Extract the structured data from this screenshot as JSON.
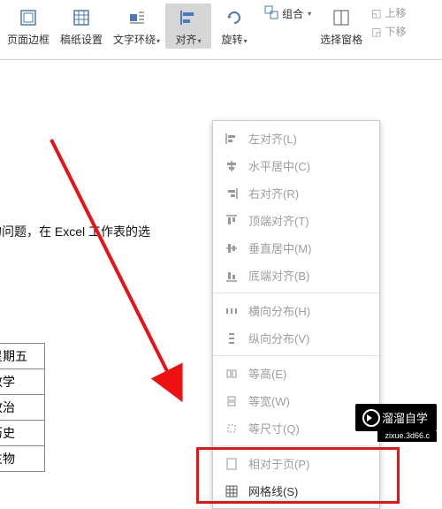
{
  "toolbar": {
    "page_border": "页面边框",
    "paper_setup": "稿纸设置",
    "text_wrap": "文字环绕",
    "align": "对齐",
    "rotate": "旋转",
    "group": "组合",
    "select_pane": "选择窗格",
    "move_up": "上移",
    "move_down": "下移"
  },
  "dropdown": {
    "items": [
      {
        "label": "左对齐(L)"
      },
      {
        "label": "水平居中(C)"
      },
      {
        "label": "右对齐(R)"
      },
      {
        "label": "顶端对齐(T)"
      },
      {
        "label": "垂直居中(M)"
      },
      {
        "label": "底端对齐(B)"
      },
      {
        "label": "横向分布(H)"
      },
      {
        "label": "纵向分布(V)"
      },
      {
        "label": "等高(E)"
      },
      {
        "label": "等宽(W)"
      },
      {
        "label": "等尺寸(Q)"
      },
      {
        "label": "相对于页(P)"
      },
      {
        "label": "网格线(S)"
      }
    ]
  },
  "doc": {
    "paragraph": "样的问题，在 Excel 工作表的选",
    "table_rows": [
      "星期五",
      "数学",
      "政治",
      "历史",
      "生物"
    ]
  },
  "watermark": {
    "main": "溜溜自学",
    "sub": "zixue.3d66.c"
  }
}
